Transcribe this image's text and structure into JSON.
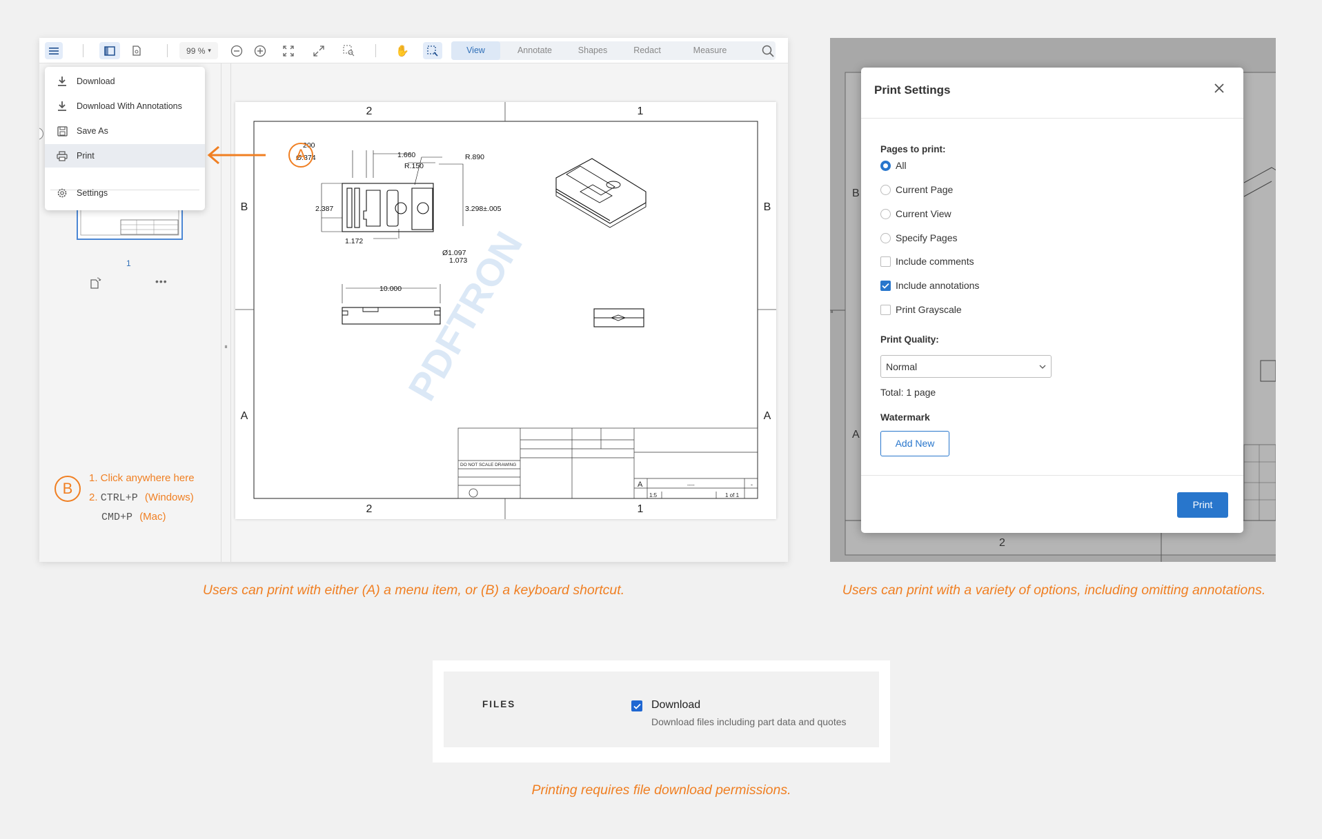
{
  "viewer": {
    "zoom": "99 %",
    "tabs": [
      "View",
      "Annotate",
      "Shapes",
      "Redact",
      "Measure"
    ],
    "active_tab": "View",
    "menu_items": [
      "Download",
      "Download With Annotations",
      "Save As",
      "Print",
      "Settings"
    ],
    "thumbnail_page": "1",
    "more_label": "•••"
  },
  "drawing": {
    "col_labels": [
      "2",
      "1"
    ],
    "row_labels": [
      "B",
      "A"
    ],
    "dims": [
      "200",
      "Ø.374",
      "1.660",
      "R.150",
      "R.890",
      "2.387",
      "3.298±.005",
      "1.172",
      "Ø1.097",
      "1.073",
      "10.000"
    ],
    "watermark": "PDFTRON",
    "title_block": {
      "size": "A",
      "scale": "1:5",
      "sheet": "1 of 1",
      "do_not_scale": "DO NOT SCALE DRAWING",
      "dash": "-",
      "dashes": "----"
    }
  },
  "annotations": {
    "a_label": "A",
    "b_label": "B",
    "step1": "1. Click anywhere here",
    "step2_num": "2.",
    "step2_key": "CTRL+P",
    "step2_os": "(Windows)",
    "step3_key": "CMD+P",
    "step3_os": "(Mac)"
  },
  "print_settings": {
    "title": "Print Settings",
    "pages_label": "Pages to print:",
    "page_options": [
      "All",
      "Current Page",
      "Current View",
      "Specify Pages"
    ],
    "selected_page_option": "All",
    "checkboxes": [
      {
        "label": "Include comments",
        "checked": false
      },
      {
        "label": "Include annotations",
        "checked": true
      },
      {
        "label": "Print Grayscale",
        "checked": false
      }
    ],
    "quality_label": "Print Quality:",
    "quality_value": "Normal",
    "total": "Total: 1 page",
    "watermark_label": "Watermark",
    "add_new": "Add New",
    "print_button": "Print"
  },
  "background_drawing": {
    "row_b": "B",
    "row_a": "A",
    "col": "2"
  },
  "permissions": {
    "section": "FILES",
    "option_label": "Download",
    "option_desc": "Download files including part data and quotes",
    "checked": true
  },
  "captions": {
    "c1": "Users can print with either (A) a menu item, or (B) a keyboard shortcut.",
    "c2": "Users can print with a variety of options, including omitting annotations.",
    "c3": "Printing requires file download permissions."
  },
  "colors": {
    "accent": "#f07f22",
    "primary": "#2876cc"
  }
}
